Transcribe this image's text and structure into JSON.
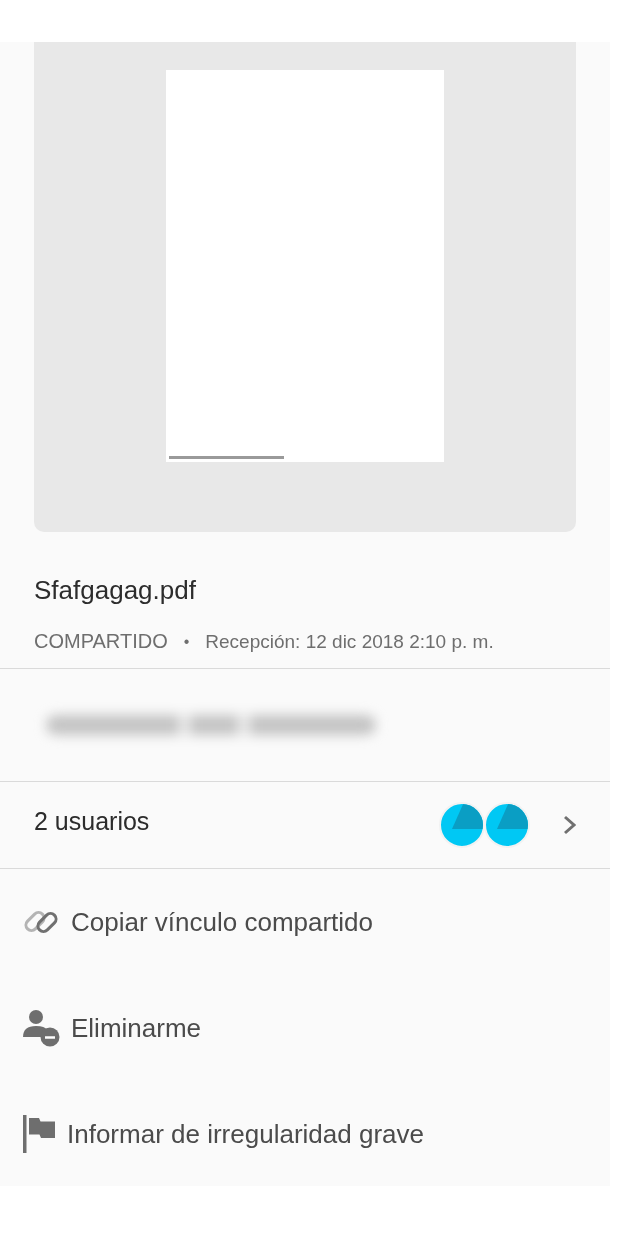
{
  "file": {
    "name": "Sfafgagag.pdf",
    "status": "COMPARTIDO",
    "separator": "•",
    "received": "Recepción: 12 dic 2018 2:10 p. m."
  },
  "users": {
    "label": "2 usuarios",
    "avatars": [
      {
        "kind": "generic"
      },
      {
        "kind": "generic"
      }
    ]
  },
  "actions": [
    {
      "kind": "link",
      "label": "Copiar vínculo compartido"
    },
    {
      "kind": "remove-self",
      "label": "Eliminarme"
    },
    {
      "kind": "report",
      "label": "Informar de irregularidad grave"
    }
  ]
}
